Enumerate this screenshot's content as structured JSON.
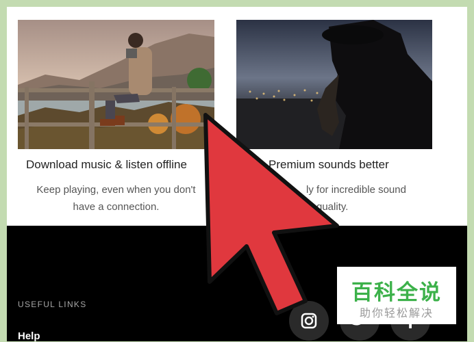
{
  "features": [
    {
      "title": "Download music & listen offline",
      "desc_line1": "Keep playing, even when you don't",
      "desc_line2": "have a connection."
    },
    {
      "title": "Premium sounds better",
      "desc_line1": "ly for incredible sound",
      "desc_line2": "quality."
    }
  ],
  "footer": {
    "useful_links": "USEFUL LINKS",
    "help": "Help",
    "social": [
      "instagram-icon",
      "twitter-icon",
      "facebook-icon"
    ]
  },
  "watermark": {
    "main": "百科全说",
    "sub": "助你轻松解决"
  },
  "colors": {
    "frame": "#c3dbb1",
    "arrow": "#e0383e",
    "watermark": "#3cb14a"
  }
}
